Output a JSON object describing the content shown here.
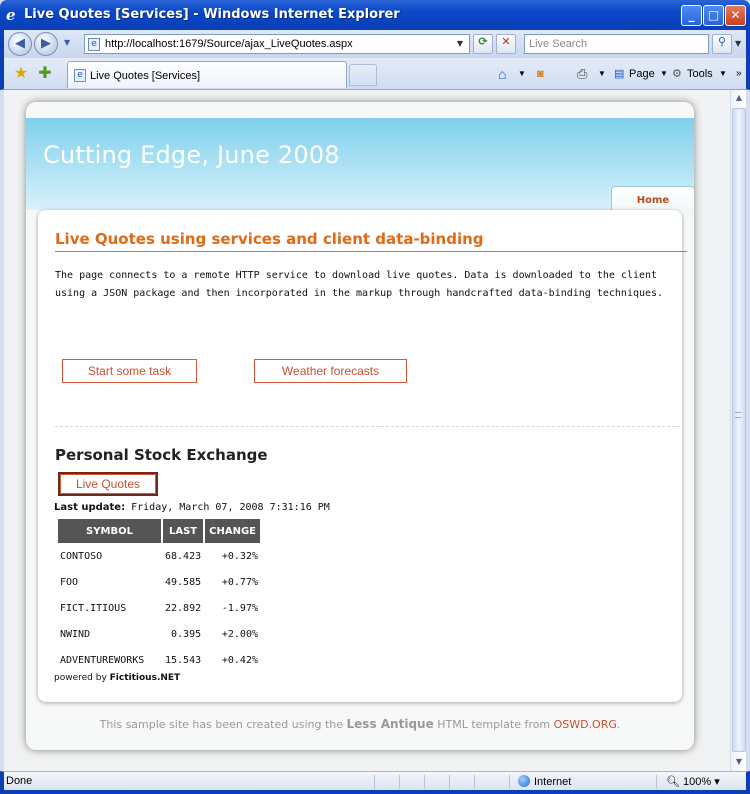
{
  "window": {
    "title": "Live Quotes [Services] - Windows Internet Explorer",
    "minimize": "_",
    "maximize": "□",
    "close": "✕"
  },
  "address": {
    "url": "http://localhost:1679/Source/ajax_LiveQuotes.aspx",
    "search_placeholder": "Live Search",
    "back": "◀",
    "forward": "▶"
  },
  "tabbar": {
    "tab_label": "Live Quotes [Services]",
    "page_label": "Page",
    "tools_label": "Tools"
  },
  "site": {
    "title": "Cutting Edge, June 2008",
    "home_tab": "Home"
  },
  "content": {
    "heading": "Live Quotes using services and client data-binding",
    "intro": "The page connects to a remote HTTP service to download live quotes. Data is downloaded to the client using a JSON package and then incorporated in the markup through handcrafted data-binding techniques.",
    "button_task": "Start some task",
    "button_weather": "Weather forecasts",
    "section_title": "Personal Stock Exchange",
    "button_live_quotes": "Live Quotes",
    "last_update_label": "Last update:",
    "last_update_value": "Friday, March 07, 2008 7:31:16 PM",
    "powered_prefix": "powered by",
    "powered_brand": "Fictitious.NET"
  },
  "quotes": {
    "headers": [
      "SYMBOL",
      "LAST",
      "CHANGE"
    ],
    "rows": [
      {
        "symbol": "CONTOSO",
        "last": "68.423",
        "change": "+0.32%"
      },
      {
        "symbol": "FOO",
        "last": "49.585",
        "change": "+0.77%"
      },
      {
        "symbol": "FICT.ITIOUS",
        "last": "22.892",
        "change": "-1.97%"
      },
      {
        "symbol": "NWIND",
        "last": "0.395",
        "change": "+2.00%"
      },
      {
        "symbol": "ADVENTUREWORKS",
        "last": "15.543",
        "change": "+0.42%"
      }
    ]
  },
  "footer": {
    "text_before": "This sample site has been created using the",
    "template_name": "Less Antique",
    "text_middle": "HTML template from",
    "source": "OSWD.ORG",
    "text_after": "."
  },
  "status": {
    "left": "Done",
    "zone": "Internet",
    "zoom": "100%"
  },
  "colors": {
    "accent": "#e06a16",
    "button_text": "#c9502d",
    "header_sky": "#7fd0ec",
    "table_header": "#555555"
  },
  "icons": [
    "ie-logo-icon",
    "back-icon",
    "forward-icon",
    "page-icon",
    "refresh-icon",
    "stop-icon",
    "search-icon",
    "favorites-star-icon",
    "add-favorites-icon",
    "home-icon",
    "feeds-icon",
    "print-icon",
    "page-icon",
    "tools-gear-icon",
    "globe-icon",
    "zoom-icon"
  ]
}
